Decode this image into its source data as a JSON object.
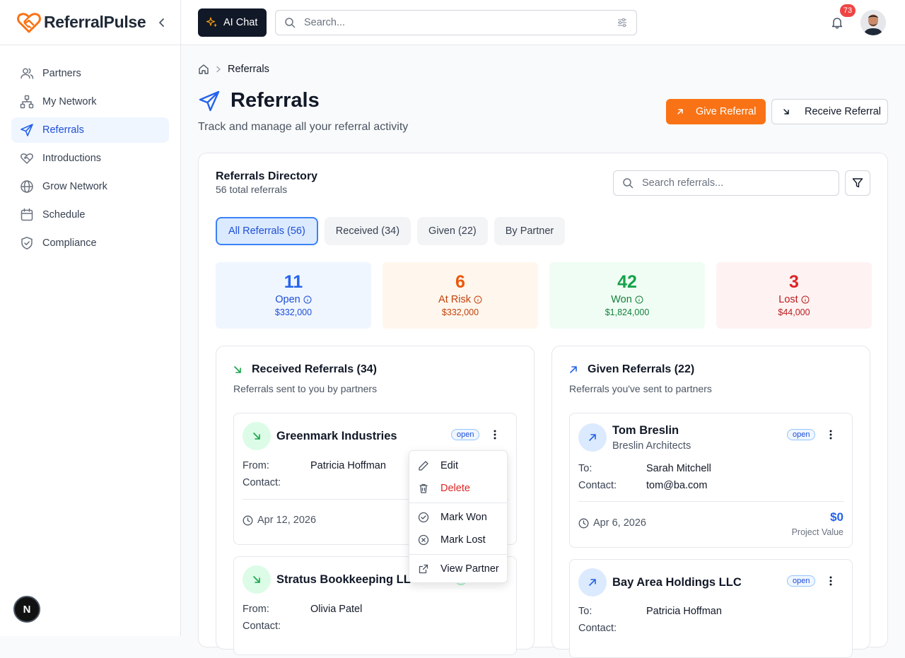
{
  "app": {
    "name": "ReferralPulse"
  },
  "sidebar": {
    "items": [
      {
        "label": "Partners",
        "icon": "users-icon"
      },
      {
        "label": "My Network",
        "icon": "network-icon"
      },
      {
        "label": "Referrals",
        "icon": "send-icon",
        "active": true
      },
      {
        "label": "Introductions",
        "icon": "handshake-icon"
      },
      {
        "label": "Grow Network",
        "icon": "globe-icon"
      },
      {
        "label": "Schedule",
        "icon": "calendar-icon"
      },
      {
        "label": "Compliance",
        "icon": "shield-check-icon"
      }
    ],
    "dev_badge": "N"
  },
  "header": {
    "ai_chat_label": "AI Chat",
    "search_placeholder": "Search...",
    "notification_count": "73"
  },
  "breadcrumb": {
    "current": "Referrals"
  },
  "page": {
    "title": "Referrals",
    "subtitle": "Track and manage all your referral activity",
    "give_label": "Give Referral",
    "receive_label": "Receive Referral"
  },
  "directory": {
    "title": "Referrals Directory",
    "subtitle": "56 total referrals",
    "search_placeholder": "Search referrals...",
    "tabs": [
      "All Referrals (56)",
      "Received (34)",
      "Given (22)",
      "By Partner"
    ],
    "active_tab": 0
  },
  "stats": [
    {
      "num": "11",
      "label": "Open",
      "amount": "$332,000"
    },
    {
      "num": "6",
      "label": "At Risk",
      "amount": "$332,000"
    },
    {
      "num": "42",
      "label": "Won",
      "amount": "$1,824,000"
    },
    {
      "num": "3",
      "label": "Lost",
      "amount": "$44,000"
    }
  ],
  "received": {
    "title": "Received Referrals (34)",
    "subtitle": "Referrals sent to you by partners",
    "cards": [
      {
        "name": "Greenmark Industries",
        "status": "open",
        "from_label": "From:",
        "from": "Patricia Hoffman",
        "contact_label": "Contact:",
        "contact": "",
        "date": "Apr 12, 2026"
      },
      {
        "name": "Stratus Bookkeeping LLC",
        "status": "",
        "from_label": "From:",
        "from": "Olivia Patel",
        "contact_label": "Contact:",
        "contact": ""
      }
    ]
  },
  "given": {
    "title": "Given Referrals (22)",
    "subtitle": "Referrals you've sent to partners",
    "cards": [
      {
        "name": "Tom Breslin",
        "company": "Breslin Architects",
        "status": "open",
        "to_label": "To:",
        "to": "Sarah Mitchell",
        "contact_label": "Contact:",
        "contact": "tom@ba.com",
        "date": "Apr 6, 2026",
        "value": "$0",
        "value_label": "Project Value"
      },
      {
        "name": "Bay Area Holdings LLC",
        "status": "open",
        "to_label": "To:",
        "to": "Patricia Hoffman",
        "contact_label": "Contact:",
        "contact": ""
      }
    ]
  },
  "menu": {
    "edit": "Edit",
    "delete": "Delete",
    "mark_won": "Mark Won",
    "mark_lost": "Mark Lost",
    "view_partner": "View Partner"
  }
}
